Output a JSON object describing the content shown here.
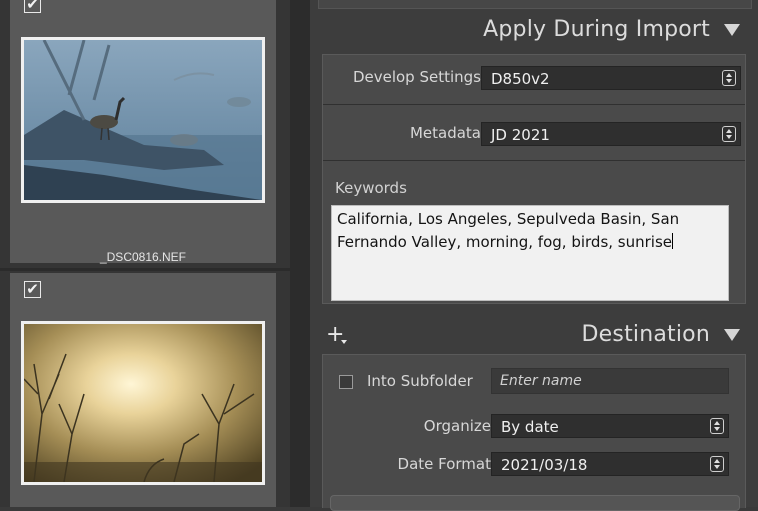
{
  "filmstrip": {
    "items": [
      {
        "checked": true,
        "check_glyph": "✔",
        "filename": "_DSC0816.NEF",
        "thumb": "goose-in-fog"
      },
      {
        "checked": true,
        "check_glyph": "✔",
        "filename": "",
        "thumb": "foggy-sunrise-trees"
      }
    ]
  },
  "apply_during_import": {
    "title": "Apply During Import",
    "develop_settings": {
      "label": "Develop Settings",
      "value": "D850v2"
    },
    "metadata": {
      "label": "Metadata",
      "value": "JD 2021"
    },
    "keywords": {
      "label": "Keywords",
      "line1": "California, Los Angeles, Sepulveda Basin, San",
      "line2": "Fernando Valley, morning, fog, birds, sunrise"
    }
  },
  "destination": {
    "title": "Destination",
    "add_icon": "+",
    "into_subfolder": {
      "label": "Into Subfolder",
      "checked": false,
      "placeholder": "Enter name"
    },
    "organize": {
      "label": "Organize",
      "value": "By date"
    },
    "date_format": {
      "label": "Date Format",
      "value": "2021/03/18"
    }
  },
  "colors": {
    "panel_bg": "#3d3d3d",
    "section_bg": "#4a4a4a",
    "select_bg": "#2f2f2f",
    "keywords_bg": "#f1f1f1"
  }
}
